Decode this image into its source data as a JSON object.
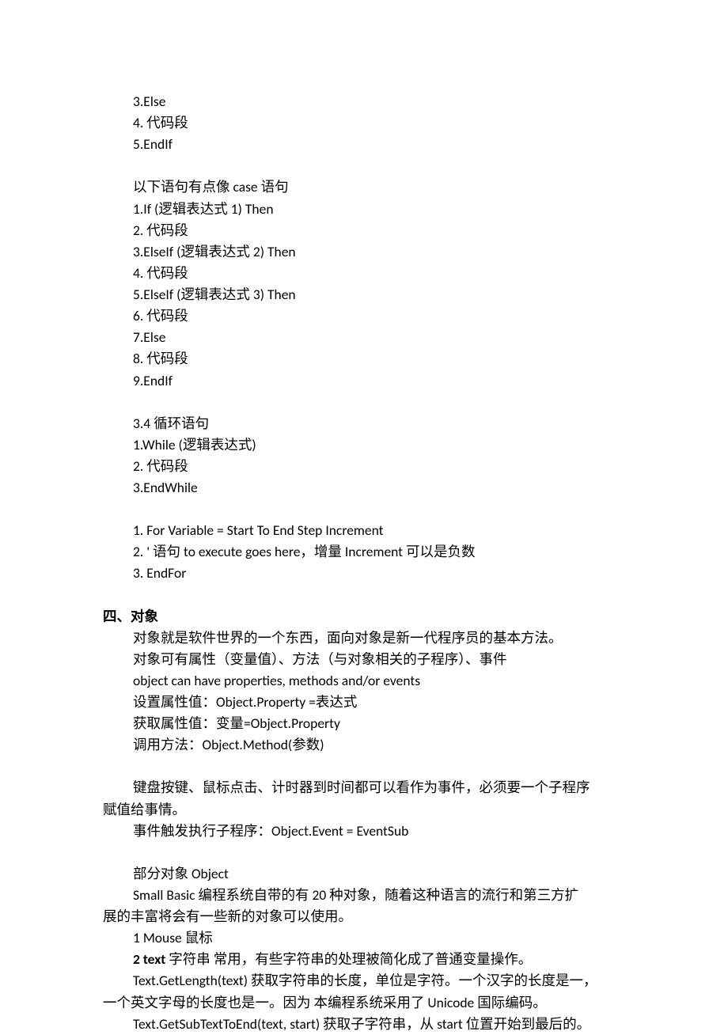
{
  "lines": {
    "l1": "3.Else",
    "l2": "4.  代码段",
    "l3": "5.EndIf",
    "l4": "以下语句有点像  case  语句",
    "l5": "1.If (逻辑表达式 1) Then",
    "l6": "2.  代码段",
    "l7": "3.ElseIf (逻辑表达式 2) Then",
    "l8": "4.  代码段",
    "l9": "5.ElseIf (逻辑表达式 3) Then",
    "l10": "6.  代码段",
    "l11": "7.Else",
    "l12": "8.  代码段",
    "l13": "9.EndIf",
    "l14": "3.4  循环语句",
    "l15": "1.While (逻辑表达式)",
    "l16": "2.  代码段",
    "l17": "3.EndWhile",
    "l18": "1. For Variable = Start To End Step Increment",
    "l19": "2. '  语句  to execute goes here，增量 Increment 可以是负数",
    "l20": "3. EndFor",
    "h1": "四、对象",
    "l21": "对象就是软件世界的一个东西，面向对象是新一代程序员的基本方法。",
    "l22": "对象可有属性（变量值）、方法（与对象相关的子程序）、事件",
    "l23": "object can have properties, methods and/or events",
    "l24": "设置属性值：Object.Property =表达式",
    "l25": "获取属性值：变量=Object.Property",
    "l26": "调用方法：Object.Method(参数)",
    "l27a": "键盘按键、鼠标点击、计时器到时间都可以看作为事件，必须要一个子程序",
    "l27b": "赋值给事情。",
    "l28": "事件触发执行子程序：Object.Event = EventSub",
    "l29": "部分对象 Object",
    "l30a": "Small Basic 编程系统自带的有 20 种对象，随着这种语言的流行和第三方扩",
    "l30b": "展的丰富将会有一些新的对象可以使用。",
    "l31": "1 Mouse  鼠标",
    "l32_bold": "2 text",
    "l32_rest": "  字符串  常用，有些字符串的处理被简化成了普通变量操作。",
    "l33a": "Text.GetLength(text)  获取字符串的长度，单位是字符。一个汉字的长度是一，",
    "l33b": "一个英文字母的长度也是一。因为  本编程系统采用了 Unicode  国际编码。",
    "l34": "Text.GetSubTextToEnd(text, start)  获取子字符串，从 start  位置开始到最后的。"
  }
}
